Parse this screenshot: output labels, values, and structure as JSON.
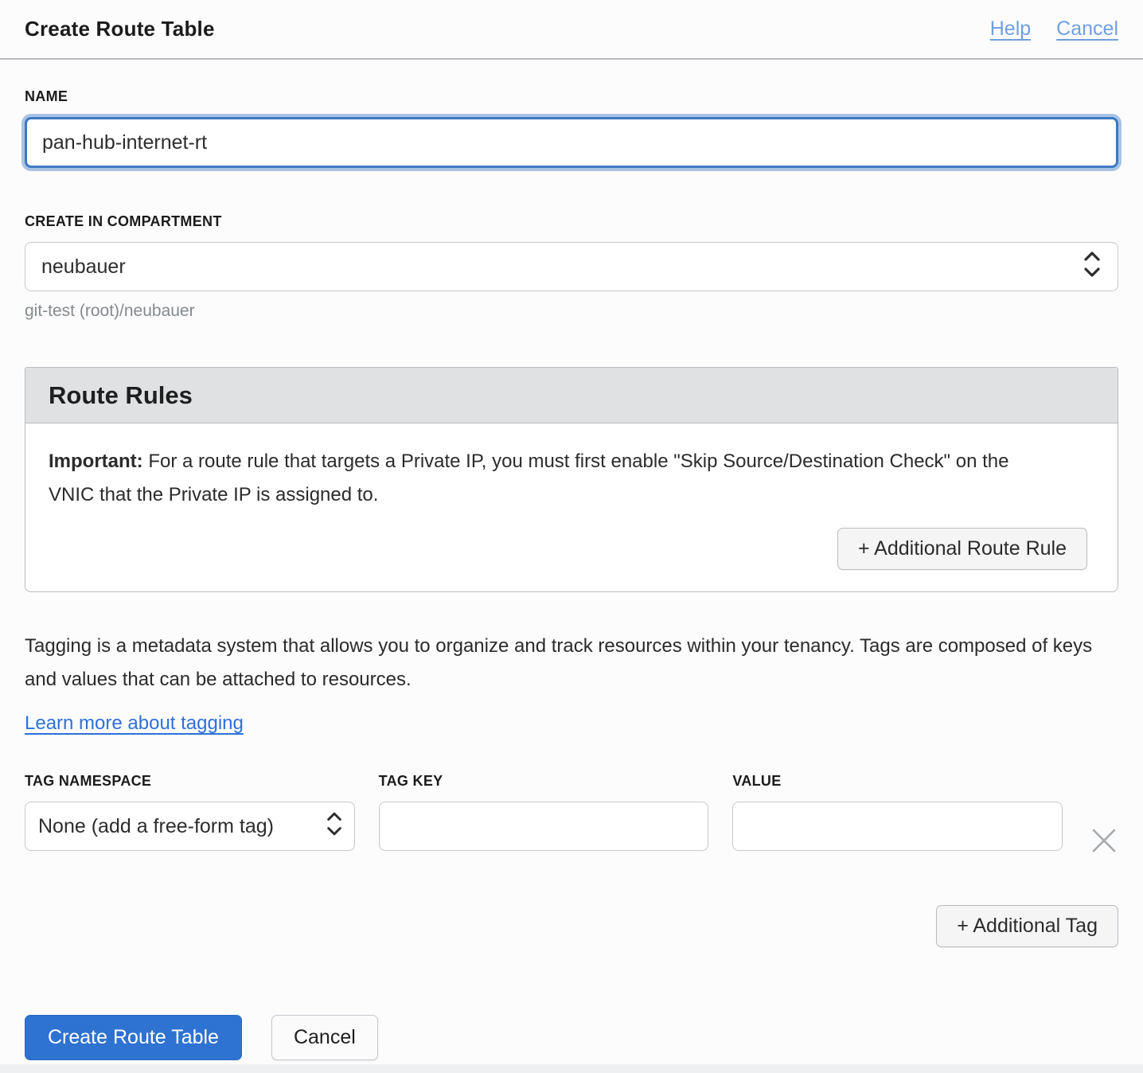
{
  "header": {
    "title": "Create Route Table",
    "help_link": "Help",
    "cancel_link": "Cancel"
  },
  "name_field": {
    "label": "NAME",
    "value": "pan-hub-internet-rt"
  },
  "compartment": {
    "label": "CREATE IN COMPARTMENT",
    "selected": "neubauer",
    "helper": "git-test (root)/neubauer"
  },
  "route_rules": {
    "title": "Route Rules",
    "important_label": "Important:",
    "important_text": " For a route rule that targets a Private IP, you must first enable \"Skip Source/Destination Check\" on the VNIC that the Private IP is assigned to.",
    "add_button": "+ Additional Route Rule"
  },
  "tagging": {
    "description": "Tagging is a metadata system that allows you to organize and track resources within your tenancy. Tags are composed of keys and values that can be attached to resources.",
    "learn_more": "Learn more about tagging",
    "namespace": {
      "label": "TAG NAMESPACE",
      "selected": "None (add a free-form tag)"
    },
    "key": {
      "label": "TAG KEY",
      "value": ""
    },
    "value": {
      "label": "VALUE",
      "value": ""
    },
    "add_button": "+ Additional Tag"
  },
  "actions": {
    "create_label": "Create Route Table",
    "cancel_label": "Cancel"
  },
  "colors": {
    "primary_blue": "#2e72d2",
    "link_blue": "#2e71d8",
    "header_link_blue": "#6f9fe0",
    "focus_border": "#3c79c4",
    "section_header_bg": "#dfe1e3"
  },
  "icons": {
    "select_stepper": "up-down chevrons",
    "remove_tag": "x"
  }
}
